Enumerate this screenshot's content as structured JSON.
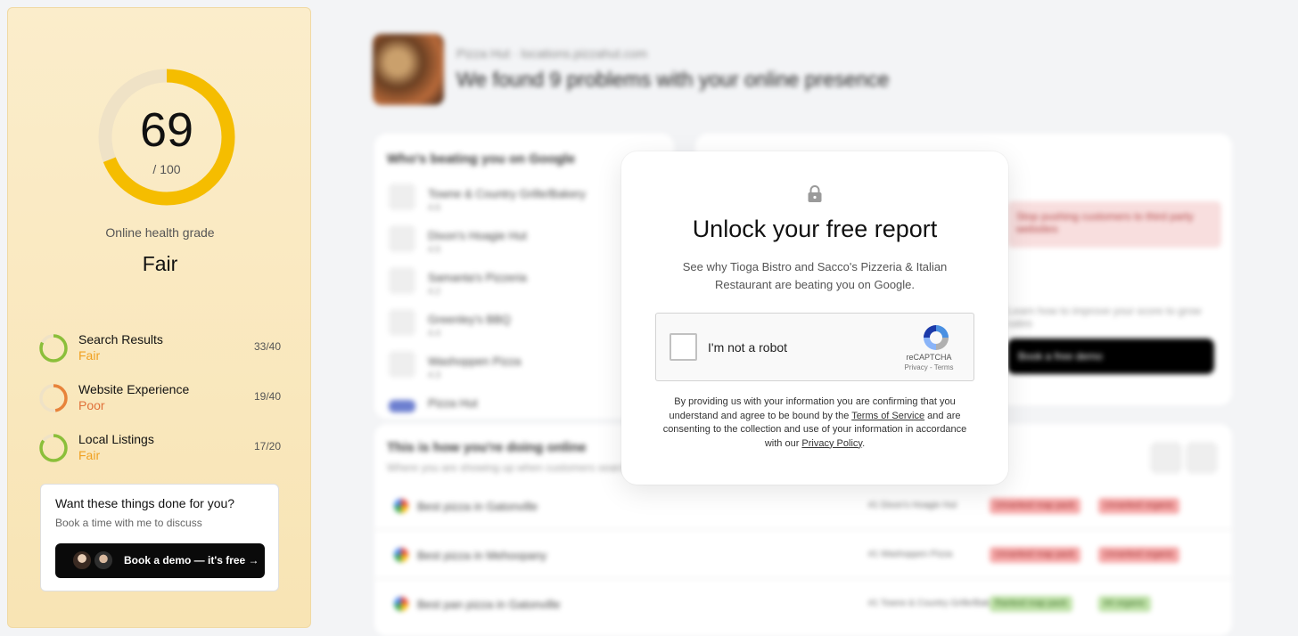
{
  "sidebar": {
    "score": "69",
    "score_max": "/ 100",
    "score_fraction": 0.69,
    "grade_label": "Online health grade",
    "grade_value": "Fair",
    "metrics": [
      {
        "name": "Search Results",
        "status": "Fair",
        "score": "33/40",
        "fraction": 0.825,
        "color": "#f0a020",
        "ring_color": "#8bbf3a"
      },
      {
        "name": "Website Experience",
        "status": "Poor",
        "score": "19/40",
        "fraction": 0.475,
        "color": "#e0713a",
        "ring_color": "#e8833a"
      },
      {
        "name": "Local Listings",
        "status": "Fair",
        "score": "17/20",
        "fraction": 0.85,
        "color": "#f0a020",
        "ring_color": "#8bbf3a"
      }
    ],
    "demo_card": {
      "title": "Want these things done for you?",
      "subtitle": "Book a time with me to discuss",
      "button_label": "Book a demo — it's free →"
    }
  },
  "background": {
    "business_line": "Pizza Hut · locations.pizzahut.com",
    "headline": "We found 9 problems with your online presence",
    "competitors_title": "Who's beating you on Google",
    "competitors": [
      {
        "name": "Towne & Country Grille/Bakery",
        "rating": "4.6"
      },
      {
        "name": "Dixon's Hoagie Hut",
        "rating": "4.5"
      },
      {
        "name": "Samanta's Pizzeria",
        "rating": "4.2"
      },
      {
        "name": "Greenley's BBQ",
        "rating": "4.4"
      },
      {
        "name": "Washoppen Pizza",
        "rating": "4.3"
      },
      {
        "name": "Pizza Hut",
        "rating": ""
      }
    ],
    "alert_text": "Stop pushing customers to third party websites",
    "improve_text": "Learn how to improve your score to grow sales",
    "cta_label": "Book a free demo",
    "online_title": "This is how you're doing online",
    "online_subtitle": "Where you are showing up when customers search",
    "searches": [
      {
        "query": "Best pizza in Gatonville",
        "winner": "#1 Dixon's Hoagie Hut",
        "tags": [
          "Unranked map pack",
          "Unranked organic"
        ],
        "tag_color": "red"
      },
      {
        "query": "Best pizza in Mehoopany",
        "winner": "#1 Washoppen Pizza",
        "tags": [
          "Unranked map pack",
          "Unranked organic"
        ],
        "tag_color": "red"
      },
      {
        "query": "Best pan pizza in Gatonville",
        "winner": "#1 Towne & Country Grille/Bakery",
        "tags": [
          "Ranked map pack",
          "#4 organic"
        ],
        "tag_color": "green"
      }
    ]
  },
  "modal": {
    "title": "Unlock your free report",
    "description": "See why Tioga Bistro and Sacco's Pizzeria & Italian Restaurant are beating you on Google.",
    "captcha_label": "I'm not a robot",
    "captcha_brand": "reCAPTCHA",
    "captcha_links": "Privacy - Terms",
    "legal_part1": "By providing us with your information you are confirming that you understand and agree to be bound by the ",
    "terms_link": "Terms of Service",
    "legal_part2": " and are consenting to the collection and use of your information in accordance with our ",
    "privacy_link": "Privacy Policy",
    "legal_end": "."
  },
  "colors": {
    "gauge_fill": "#f5bd00",
    "gauge_track": "#efe2c6",
    "fair": "#f0a020",
    "poor": "#e0713a"
  },
  "icons": {
    "lock": "lock-icon",
    "recaptcha": "recaptcha-logo-icon",
    "google": "google-icon"
  }
}
